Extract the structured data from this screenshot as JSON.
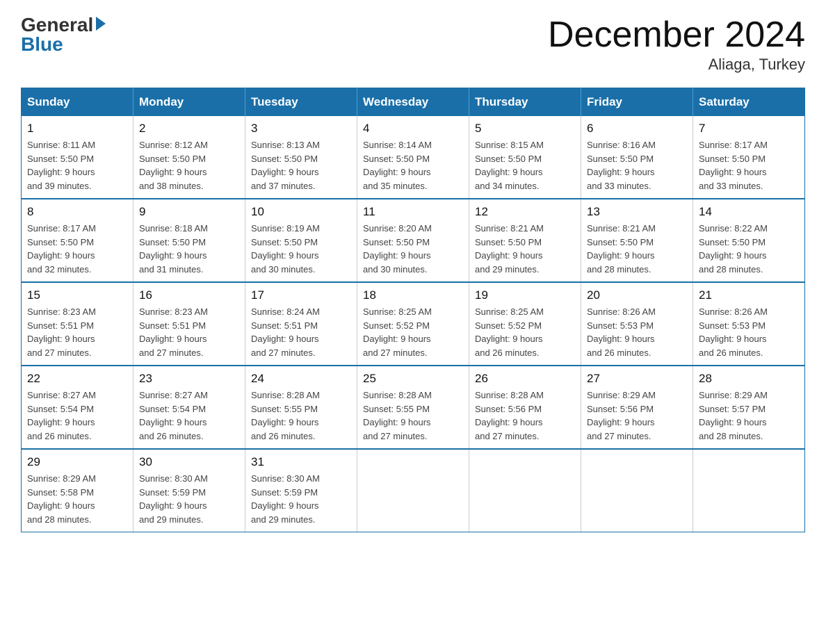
{
  "logo": {
    "general": "General",
    "blue": "Blue"
  },
  "title": {
    "month": "December 2024",
    "location": "Aliaga, Turkey"
  },
  "days_header": [
    "Sunday",
    "Monday",
    "Tuesday",
    "Wednesday",
    "Thursday",
    "Friday",
    "Saturday"
  ],
  "weeks": [
    [
      {
        "day": "1",
        "sunrise": "8:11 AM",
        "sunset": "5:50 PM",
        "daylight": "9 hours and 39 minutes."
      },
      {
        "day": "2",
        "sunrise": "8:12 AM",
        "sunset": "5:50 PM",
        "daylight": "9 hours and 38 minutes."
      },
      {
        "day": "3",
        "sunrise": "8:13 AM",
        "sunset": "5:50 PM",
        "daylight": "9 hours and 37 minutes."
      },
      {
        "day": "4",
        "sunrise": "8:14 AM",
        "sunset": "5:50 PM",
        "daylight": "9 hours and 35 minutes."
      },
      {
        "day": "5",
        "sunrise": "8:15 AM",
        "sunset": "5:50 PM",
        "daylight": "9 hours and 34 minutes."
      },
      {
        "day": "6",
        "sunrise": "8:16 AM",
        "sunset": "5:50 PM",
        "daylight": "9 hours and 33 minutes."
      },
      {
        "day": "7",
        "sunrise": "8:17 AM",
        "sunset": "5:50 PM",
        "daylight": "9 hours and 33 minutes."
      }
    ],
    [
      {
        "day": "8",
        "sunrise": "8:17 AM",
        "sunset": "5:50 PM",
        "daylight": "9 hours and 32 minutes."
      },
      {
        "day": "9",
        "sunrise": "8:18 AM",
        "sunset": "5:50 PM",
        "daylight": "9 hours and 31 minutes."
      },
      {
        "day": "10",
        "sunrise": "8:19 AM",
        "sunset": "5:50 PM",
        "daylight": "9 hours and 30 minutes."
      },
      {
        "day": "11",
        "sunrise": "8:20 AM",
        "sunset": "5:50 PM",
        "daylight": "9 hours and 30 minutes."
      },
      {
        "day": "12",
        "sunrise": "8:21 AM",
        "sunset": "5:50 PM",
        "daylight": "9 hours and 29 minutes."
      },
      {
        "day": "13",
        "sunrise": "8:21 AM",
        "sunset": "5:50 PM",
        "daylight": "9 hours and 28 minutes."
      },
      {
        "day": "14",
        "sunrise": "8:22 AM",
        "sunset": "5:50 PM",
        "daylight": "9 hours and 28 minutes."
      }
    ],
    [
      {
        "day": "15",
        "sunrise": "8:23 AM",
        "sunset": "5:51 PM",
        "daylight": "9 hours and 27 minutes."
      },
      {
        "day": "16",
        "sunrise": "8:23 AM",
        "sunset": "5:51 PM",
        "daylight": "9 hours and 27 minutes."
      },
      {
        "day": "17",
        "sunrise": "8:24 AM",
        "sunset": "5:51 PM",
        "daylight": "9 hours and 27 minutes."
      },
      {
        "day": "18",
        "sunrise": "8:25 AM",
        "sunset": "5:52 PM",
        "daylight": "9 hours and 27 minutes."
      },
      {
        "day": "19",
        "sunrise": "8:25 AM",
        "sunset": "5:52 PM",
        "daylight": "9 hours and 26 minutes."
      },
      {
        "day": "20",
        "sunrise": "8:26 AM",
        "sunset": "5:53 PM",
        "daylight": "9 hours and 26 minutes."
      },
      {
        "day": "21",
        "sunrise": "8:26 AM",
        "sunset": "5:53 PM",
        "daylight": "9 hours and 26 minutes."
      }
    ],
    [
      {
        "day": "22",
        "sunrise": "8:27 AM",
        "sunset": "5:54 PM",
        "daylight": "9 hours and 26 minutes."
      },
      {
        "day": "23",
        "sunrise": "8:27 AM",
        "sunset": "5:54 PM",
        "daylight": "9 hours and 26 minutes."
      },
      {
        "day": "24",
        "sunrise": "8:28 AM",
        "sunset": "5:55 PM",
        "daylight": "9 hours and 26 minutes."
      },
      {
        "day": "25",
        "sunrise": "8:28 AM",
        "sunset": "5:55 PM",
        "daylight": "9 hours and 27 minutes."
      },
      {
        "day": "26",
        "sunrise": "8:28 AM",
        "sunset": "5:56 PM",
        "daylight": "9 hours and 27 minutes."
      },
      {
        "day": "27",
        "sunrise": "8:29 AM",
        "sunset": "5:56 PM",
        "daylight": "9 hours and 27 minutes."
      },
      {
        "day": "28",
        "sunrise": "8:29 AM",
        "sunset": "5:57 PM",
        "daylight": "9 hours and 28 minutes."
      }
    ],
    [
      {
        "day": "29",
        "sunrise": "8:29 AM",
        "sunset": "5:58 PM",
        "daylight": "9 hours and 28 minutes."
      },
      {
        "day": "30",
        "sunrise": "8:30 AM",
        "sunset": "5:59 PM",
        "daylight": "9 hours and 29 minutes."
      },
      {
        "day": "31",
        "sunrise": "8:30 AM",
        "sunset": "5:59 PM",
        "daylight": "9 hours and 29 minutes."
      },
      null,
      null,
      null,
      null
    ]
  ],
  "labels": {
    "sunrise": "Sunrise:",
    "sunset": "Sunset:",
    "daylight": "Daylight:"
  }
}
